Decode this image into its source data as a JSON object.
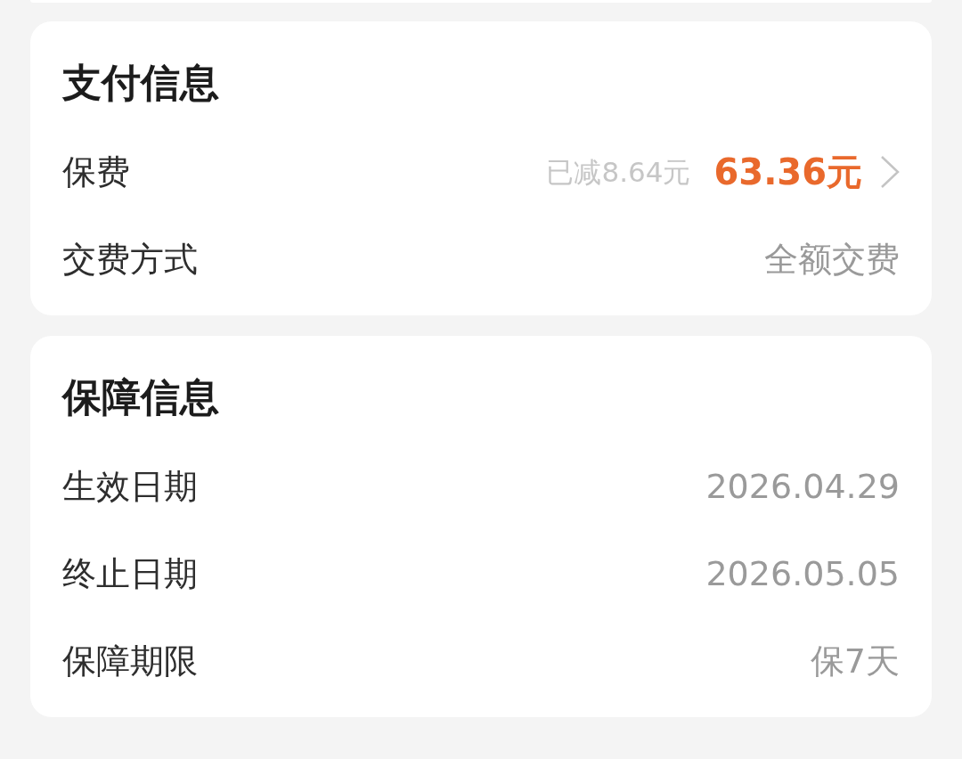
{
  "sections": [
    {
      "title": "支付信息",
      "rows": [
        {
          "kind": "price",
          "label": "保费",
          "discount": "已减8.64元",
          "value": "63.36元"
        },
        {
          "kind": "text",
          "label": "交费方式",
          "value": "全额交费"
        }
      ]
    },
    {
      "title": "保障信息",
      "rows": [
        {
          "kind": "text",
          "label": "生效日期",
          "value": "2026.04.29"
        },
        {
          "kind": "text",
          "label": "终止日期",
          "value": "2026.05.05"
        },
        {
          "kind": "text",
          "label": "保障期限",
          "value": "保7天"
        }
      ]
    }
  ]
}
